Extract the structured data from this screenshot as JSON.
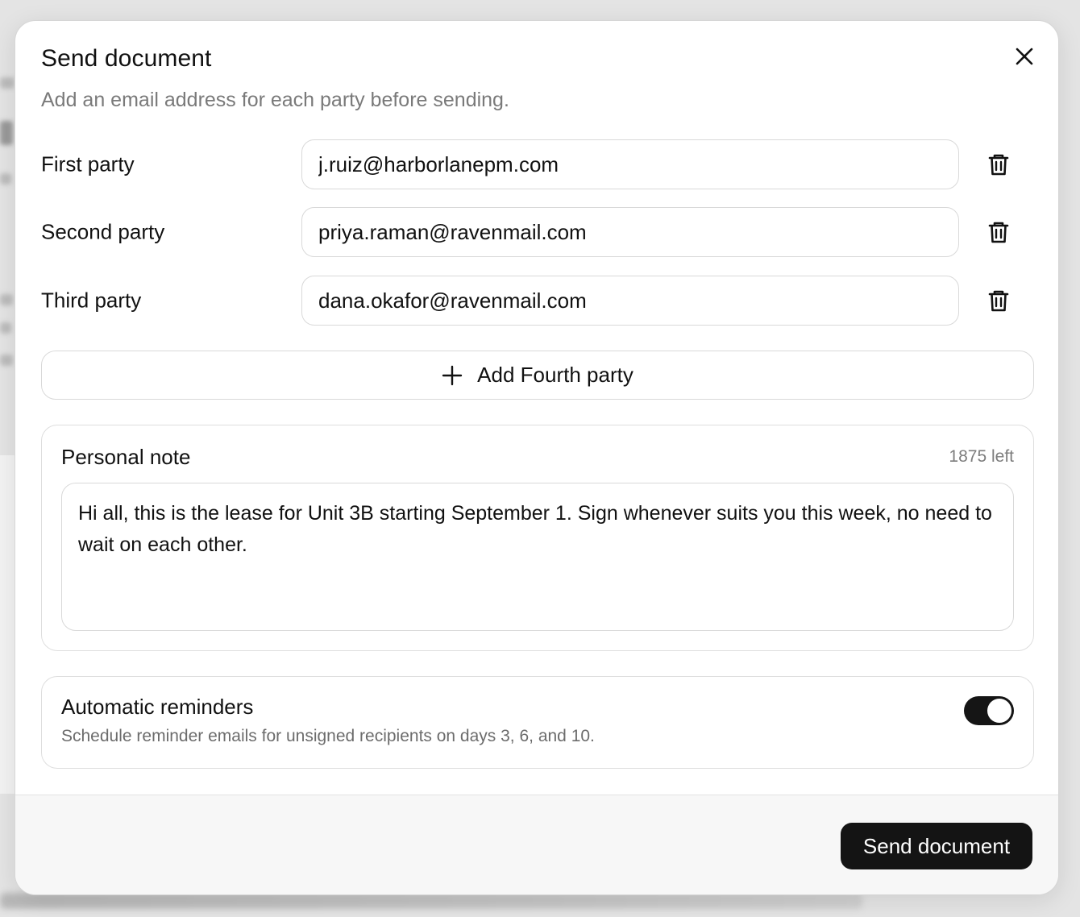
{
  "dialog": {
    "title": "Send document",
    "subtitle": "Add an email address for each party before sending."
  },
  "parties": [
    {
      "label": "First party",
      "email": "j.ruiz@harborlanepm.com"
    },
    {
      "label": "Second party",
      "email": "priya.raman@ravenmail.com"
    },
    {
      "label": "Third party",
      "email": "dana.okafor@ravenmail.com"
    }
  ],
  "add_party": {
    "label": "Add Fourth party"
  },
  "note": {
    "title": "Personal note",
    "counter": "1875 left",
    "text": "Hi all, this is the lease for Unit 3B starting September 1. Sign whenever suits you this week, no need to wait on each other."
  },
  "reminders": {
    "title": "Automatic reminders",
    "description": "Schedule reminder emails for unsigned recipients on days 3, 6, and 10.",
    "enabled": true
  },
  "footer": {
    "send_label": "Send document"
  },
  "colors": {
    "primary": "#141414",
    "muted_text": "#7a7a7a",
    "border": "#d9d9d9",
    "footer_bg": "#f7f7f7"
  },
  "icons": {
    "close": "close-icon",
    "trash": "trash-icon",
    "plus": "plus-icon"
  }
}
